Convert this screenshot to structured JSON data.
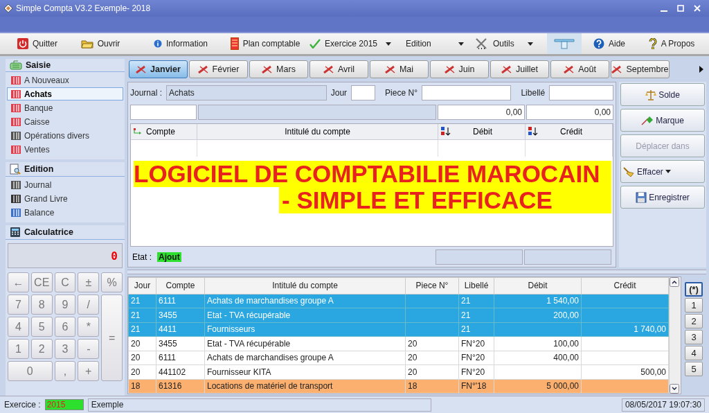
{
  "window": {
    "title": "Simple Compta V3.2 Exemple- 2018"
  },
  "toolbar": [
    {
      "label": "Quitter",
      "kind": "quit"
    },
    {
      "label": "Ouvrir",
      "kind": "open"
    },
    {
      "label": "Information",
      "kind": "info"
    },
    {
      "label": "Plan comptable",
      "kind": "plan"
    },
    {
      "label": "Exercice 2015",
      "kind": "check",
      "dropdown": true
    },
    {
      "label": "Edition",
      "kind": "plain",
      "dropdown": true
    },
    {
      "label": "Outils",
      "kind": "tools",
      "dropdown": true
    },
    {
      "kind": "ruler",
      "active": true
    },
    {
      "label": "Aide",
      "kind": "help"
    },
    {
      "label": "A Propos",
      "kind": "about"
    }
  ],
  "sidebar": {
    "sections": [
      {
        "title": "Saisie",
        "kind": "saisie",
        "items": [
          {
            "label": "A Nouveaux",
            "selected": false,
            "color": "#e03c4c"
          },
          {
            "label": "Achats",
            "selected": true,
            "color": "#e03c4c"
          },
          {
            "label": "Banque",
            "selected": false,
            "color": "#e03c4c"
          },
          {
            "label": "Caisse",
            "selected": false,
            "color": "#e03c4c"
          },
          {
            "label": "Opérations divers",
            "selected": false,
            "color": "#505050"
          },
          {
            "label": "Ventes",
            "selected": false,
            "color": "#e03c4c"
          }
        ]
      },
      {
        "title": "Edition",
        "kind": "edition",
        "items": [
          {
            "label": "Journal",
            "selected": false,
            "color": "#505050"
          },
          {
            "label": "Grand Livre",
            "selected": false,
            "color": "#303030"
          },
          {
            "label": "Balance",
            "selected": false,
            "color": "#3a6fc8"
          }
        ]
      }
    ],
    "calculator": {
      "title": "Calculatrice",
      "display": "0",
      "keys": [
        {
          "label": "←",
          "kind": "key"
        },
        {
          "label": "CE",
          "kind": "key"
        },
        {
          "label": "C",
          "kind": "key"
        },
        {
          "label": "±",
          "kind": "key"
        },
        {
          "label": "%",
          "kind": "key"
        },
        {
          "label": "7",
          "kind": "key"
        },
        {
          "label": "8",
          "kind": "key"
        },
        {
          "label": "9",
          "kind": "key"
        },
        {
          "label": "/",
          "kind": "key"
        },
        {
          "label": "=",
          "kind": "tall"
        },
        {
          "label": "4",
          "kind": "key"
        },
        {
          "label": "5",
          "kind": "key"
        },
        {
          "label": "6",
          "kind": "key"
        },
        {
          "label": "*",
          "kind": "key"
        },
        {
          "label": "1",
          "kind": "key"
        },
        {
          "label": "2",
          "kind": "key"
        },
        {
          "label": "3",
          "kind": "key"
        },
        {
          "label": "-",
          "kind": "key"
        },
        {
          "label": "0",
          "kind": "wide"
        },
        {
          "label": ",",
          "kind": "key"
        },
        {
          "label": "+",
          "kind": "key"
        }
      ]
    }
  },
  "months": [
    {
      "label": "Janvier",
      "selected": true
    },
    {
      "label": "Février",
      "selected": false
    },
    {
      "label": "Mars",
      "selected": false
    },
    {
      "label": "Avril",
      "selected": false
    },
    {
      "label": "Mai",
      "selected": false
    },
    {
      "label": "Juin",
      "selected": false
    },
    {
      "label": "Juillet",
      "selected": false
    },
    {
      "label": "Août",
      "selected": false
    },
    {
      "label": "Septembre",
      "selected": false
    }
  ],
  "entry": {
    "journal_label": "Journal :",
    "journal": "Achats",
    "jour_label": "Jour",
    "piece_label": "Piece N°",
    "libelle_label": "Libellé",
    "total_debit": "0,00",
    "total_credit": "0,00",
    "columns": [
      "Compte",
      "Intitulé du compte",
      "Débit",
      "Crédit"
    ],
    "banner": [
      "LOGICIEL DE COMPTABILIE MAROCAIN",
      "- SIMPLE ET EFFICACE"
    ],
    "etat_label": "Etat :",
    "etat": "Ajout"
  },
  "actions": [
    {
      "label": "Solde",
      "kind": "scale",
      "disabled": false
    },
    {
      "label": "Marque",
      "kind": "mark",
      "disabled": false
    },
    {
      "label": "Déplacer dans",
      "kind": "none",
      "disabled": true
    },
    {
      "label": "Effacer",
      "kind": "broom",
      "disabled": false,
      "dropdown": true
    },
    {
      "label": "Enregistrer",
      "kind": "save",
      "disabled": false
    }
  ],
  "table": {
    "columns": [
      "Jour",
      "Compte",
      "Intitulé du compte",
      "Piece N°",
      "Libellé",
      "Débit",
      "Crédit"
    ],
    "rows": [
      {
        "jour": "21",
        "compte": "6111",
        "intitule": "Achats de marchandises groupe A",
        "libelle": "21",
        "debit": "1 540,00",
        "selected": true,
        "highlighted": false
      },
      {
        "jour": "21",
        "compte": "3455",
        "intitule": "Etat - TVA récupérable",
        "libelle": "21",
        "debit": "200,00",
        "selected": true,
        "highlighted": false
      },
      {
        "jour": "21",
        "compte": "4411",
        "intitule": "Fournisseurs",
        "libelle": "21",
        "credit": "1 740,00",
        "selected": true,
        "highlighted": false
      },
      {
        "jour": "20",
        "compte": "3455",
        "intitule": "Etat - TVA récupérable",
        "piece": "20",
        "libelle": "FN°20",
        "debit": "100,00",
        "selected": false,
        "highlighted": false
      },
      {
        "jour": "20",
        "compte": "6111",
        "intitule": "Achats de marchandises groupe A",
        "piece": "20",
        "libelle": "FN°20",
        "debit": "400,00",
        "selected": false,
        "highlighted": false
      },
      {
        "jour": "20",
        "compte": "441102",
        "intitule": "Fournisseur KITA",
        "piece": "20",
        "libelle": "FN°20",
        "credit": "500,00",
        "selected": false,
        "highlighted": false
      },
      {
        "jour": "18",
        "compte": "61316",
        "intitule": "Locations de matériel de transport",
        "piece": "18",
        "libelle": "FN°'18",
        "debit": "5 000,00",
        "selected": false,
        "highlighted": true
      }
    ]
  },
  "pages": [
    {
      "label": "(*)",
      "selected": true
    },
    {
      "label": "1",
      "selected": false
    },
    {
      "label": "2",
      "selected": false
    },
    {
      "label": "3",
      "selected": false
    },
    {
      "label": "4",
      "selected": false
    },
    {
      "label": "5",
      "selected": false
    }
  ],
  "status_bar": {
    "exercice_label": "Exercice :",
    "exercice": "2015",
    "file": "Exemple",
    "datetime": "08/05/2017 19:07:30"
  }
}
